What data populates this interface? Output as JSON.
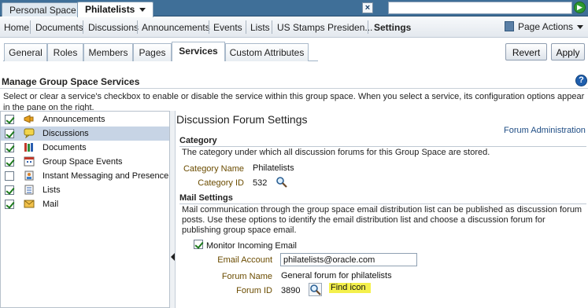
{
  "top_tabs": [
    "Personal Space",
    "Philatelists"
  ],
  "nav": {
    "items": [
      "Home",
      "Documents",
      "Discussions",
      "Announcements",
      "Events",
      "Lists",
      "US Stamps Presiden...",
      "Settings"
    ],
    "page_actions": "Page Actions"
  },
  "sub_tabs": [
    "General",
    "Roles",
    "Members",
    "Pages",
    "Services",
    "Custom Attributes"
  ],
  "buttons": {
    "revert": "Revert",
    "apply": "Apply"
  },
  "page": {
    "heading": "Manage Group Space Services",
    "description": "Select or clear a service's checkbox to enable or disable the service within this group space. When you select a service, its configuration options appear in the pane on the right."
  },
  "services": [
    {
      "label": "Announcements",
      "checked": true,
      "icon": "megaphone-icon",
      "selected": false
    },
    {
      "label": "Discussions",
      "checked": true,
      "icon": "speech-bubble-icon",
      "selected": true
    },
    {
      "label": "Documents",
      "checked": true,
      "icon": "books-icon",
      "selected": false
    },
    {
      "label": "Group Space Events",
      "checked": true,
      "icon": "calendar-icon",
      "selected": false
    },
    {
      "label": "Instant Messaging and Presence",
      "checked": false,
      "icon": "im-presence-icon",
      "selected": false
    },
    {
      "label": "Lists",
      "checked": true,
      "icon": "list-icon",
      "selected": false
    },
    {
      "label": "Mail",
      "checked": true,
      "icon": "envelope-icon",
      "selected": false
    }
  ],
  "settings": {
    "title": "Discussion Forum Settings",
    "admin_link": "Forum Administration",
    "category": {
      "heading": "Category",
      "text": "The category under which all discussion forums for this Group Space are stored.",
      "name_label": "Category Name",
      "name_value": "Philatelists",
      "id_label": "Category ID",
      "id_value": "532"
    },
    "mail": {
      "heading": "Mail Settings",
      "text_lines": [
        "Mail communication through the group space email distribution list can be published as discussion forum",
        "posts. Use these options to identify the email distribution list and choose a discussion forum for",
        "publishing group space email."
      ],
      "monitor_label": "Monitor Incoming Email",
      "email_label": "Email Account",
      "email_value": "philatelists@oracle.com",
      "forum_name_label": "Forum Name",
      "forum_name_value": "General forum for philatelists",
      "forum_id_label": "Forum ID",
      "forum_id_value": "3890",
      "find_icon_callout": "Find icon"
    }
  }
}
